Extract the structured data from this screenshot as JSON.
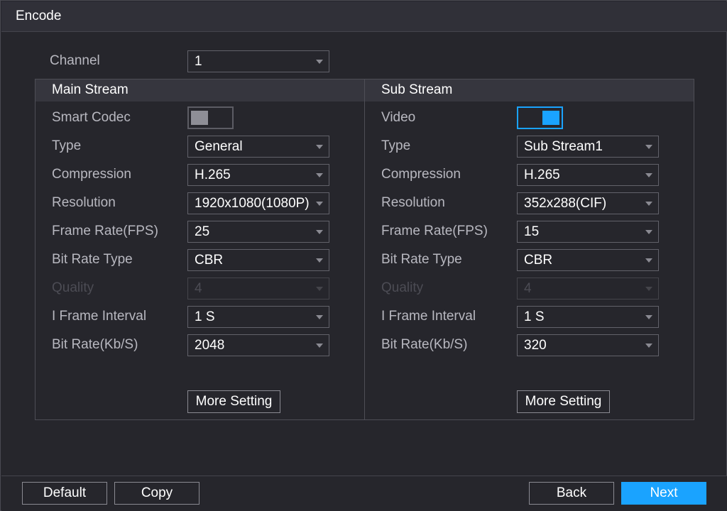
{
  "window": {
    "title": "Encode"
  },
  "channel": {
    "label": "Channel",
    "value": "1"
  },
  "main_stream": {
    "header": "Main Stream",
    "smart_codec": {
      "label": "Smart Codec",
      "enabled": false
    },
    "type": {
      "label": "Type",
      "value": "General"
    },
    "compression": {
      "label": "Compression",
      "value": "H.265"
    },
    "resolution": {
      "label": "Resolution",
      "value": "1920x1080(1080P)"
    },
    "frame_rate": {
      "label": "Frame Rate(FPS)",
      "value": "25"
    },
    "bit_rate_type": {
      "label": "Bit Rate Type",
      "value": "CBR"
    },
    "quality": {
      "label": "Quality",
      "value": "4"
    },
    "i_frame_interval": {
      "label": "I Frame Interval",
      "value": "1 S"
    },
    "bit_rate": {
      "label": "Bit Rate(Kb/S)",
      "value": "2048"
    },
    "more_setting": "More Setting"
  },
  "sub_stream": {
    "header": "Sub Stream",
    "video": {
      "label": "Video",
      "enabled": true
    },
    "type": {
      "label": "Type",
      "value": "Sub Stream1"
    },
    "compression": {
      "label": "Compression",
      "value": "H.265"
    },
    "resolution": {
      "label": "Resolution",
      "value": "352x288(CIF)"
    },
    "frame_rate": {
      "label": "Frame Rate(FPS)",
      "value": "15"
    },
    "bit_rate_type": {
      "label": "Bit Rate Type",
      "value": "CBR"
    },
    "quality": {
      "label": "Quality",
      "value": "4"
    },
    "i_frame_interval": {
      "label": "I Frame Interval",
      "value": "1 S"
    },
    "bit_rate": {
      "label": "Bit Rate(Kb/S)",
      "value": "320"
    },
    "more_setting": "More Setting"
  },
  "footer": {
    "default_label": "Default",
    "copy_label": "Copy",
    "back_label": "Back",
    "next_label": "Next"
  },
  "colors": {
    "accent": "#1aa3ff",
    "background": "#26262c",
    "label_text": "#b8b8c0",
    "disabled_text": "#4c4c54"
  }
}
